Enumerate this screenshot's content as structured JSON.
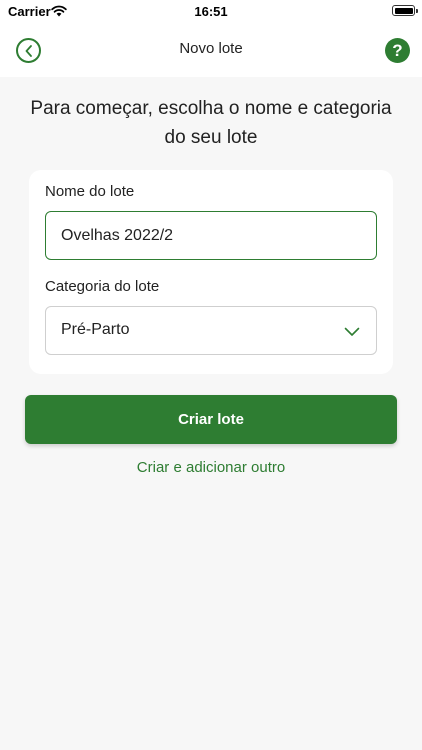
{
  "status_bar": {
    "carrier": "Carrier",
    "time": "16:51",
    "wifi_icon": "wifi-icon",
    "battery_icon": "battery-icon"
  },
  "nav": {
    "title": "Novo lote",
    "back_icon": "chevron-left-icon",
    "help_icon": "question-mark-icon",
    "help_glyph": "?"
  },
  "heading": "Para começar, escolha o nome e categoria do seu lote",
  "form": {
    "name_label": "Nome do lote",
    "name_value": "Ovelhas 2022/2",
    "category_label": "Categoria do lote",
    "category_value": "Pré-Parto",
    "category_icon": "chevron-down-icon"
  },
  "actions": {
    "create_label": "Criar lote",
    "create_and_add_label": "Criar e adicionar outro"
  },
  "colors": {
    "accent": "#2e7d32",
    "background": "#f7f7f7",
    "card": "#ffffff"
  }
}
